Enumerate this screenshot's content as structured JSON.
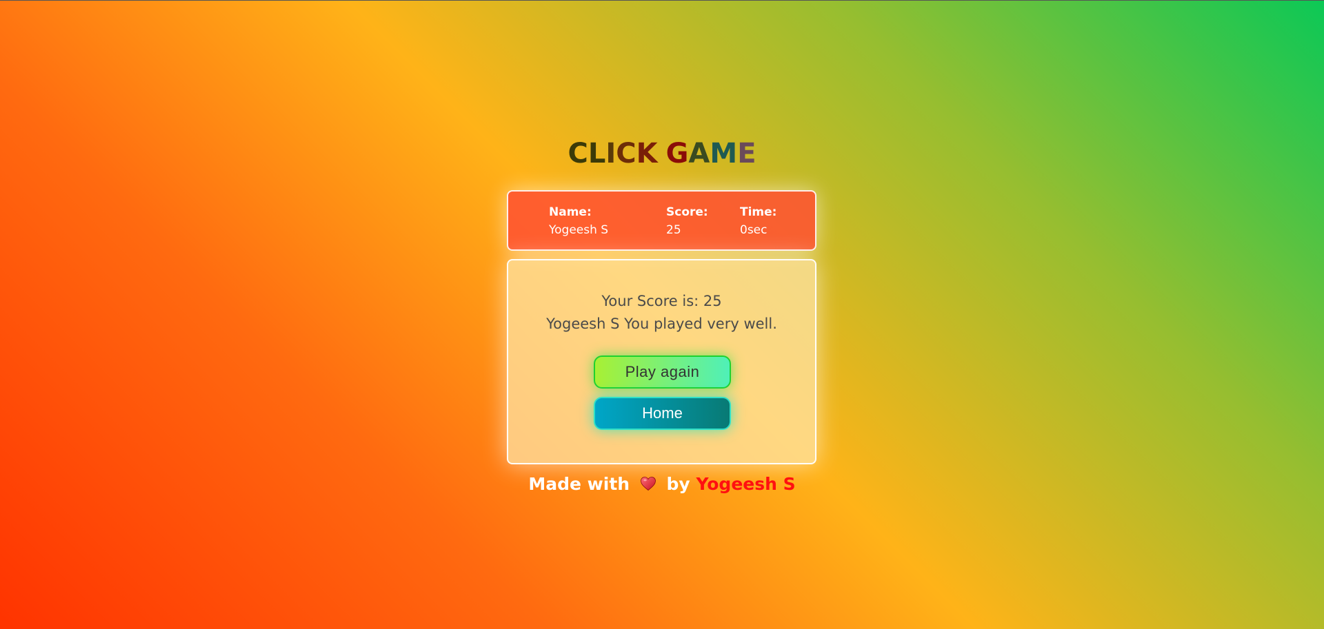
{
  "title": {
    "letters": [
      {
        "ch": "C",
        "color": "#3b3a08"
      },
      {
        "ch": "L",
        "color": "#3b3a08"
      },
      {
        "ch": "I",
        "color": "#5a3a08"
      },
      {
        "ch": "C",
        "color": "#6d2c08"
      },
      {
        "ch": "K",
        "color": "#7a1f08"
      },
      {
        "ch": " ",
        "color": "#7a1f08"
      },
      {
        "ch": "G",
        "color": "#8a0c08"
      },
      {
        "ch": "A",
        "color": "#3a4a20"
      },
      {
        "ch": "M",
        "color": "#1f5a52"
      },
      {
        "ch": "E",
        "color": "#6a4a5a"
      }
    ]
  },
  "info": {
    "name_label": "Name:",
    "name_value": "Yogeesh S",
    "score_label": "Score:",
    "score_value": "25",
    "time_label": "Time:",
    "time_value": "0sec"
  },
  "result": {
    "score_text": "Your Score is: 25",
    "message": "Yogeesh S You played very well."
  },
  "buttons": {
    "play_again": "Play again",
    "home": "Home"
  },
  "footer": {
    "made_with": "Made with",
    "heart_icon": "heart-icon",
    "by": "by",
    "author": "Yogeesh S",
    "author_color": "#ff1010"
  },
  "colors": {
    "info_card_bg": "#ff5a32",
    "play_btn_border": "#1fd12f",
    "home_btn_start": "#00a6c8",
    "home_btn_end": "#087a74"
  }
}
